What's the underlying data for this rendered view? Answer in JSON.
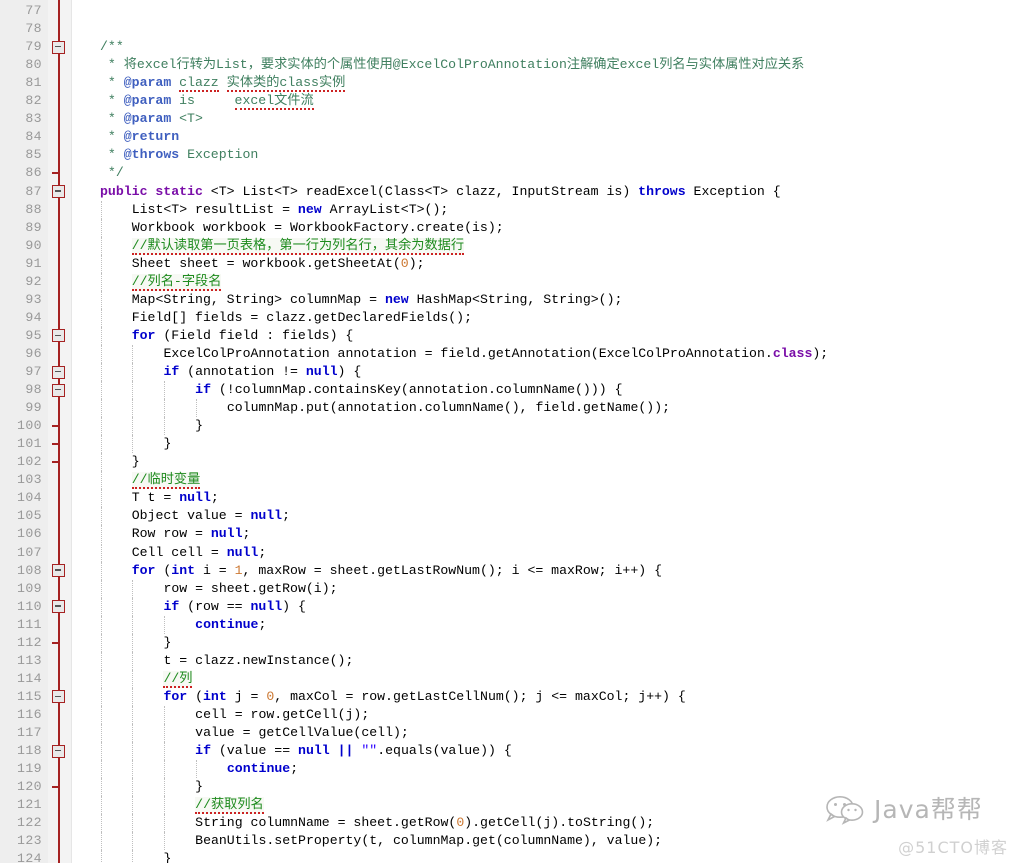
{
  "editor": {
    "first_line": 77,
    "last_line": 124,
    "language": "java",
    "colors": {
      "background": "#ffffff",
      "gutter_background": "#eeeeee",
      "line_number": "#999999",
      "fold_rail": "#a52222",
      "keyword_modifier": "#7a0ea8",
      "keyword": "#0000cc",
      "javadoc_comment": "#3f7f5f",
      "line_comment": "#1e8b1e",
      "javadoc_tag": "#3f5fbf",
      "number_literal": "#cc7832",
      "string_literal": "#2a00ff",
      "spellcheck_underline": "#cc2222",
      "indent_guide": "#bfbfbf"
    }
  },
  "lines": [
    {
      "n": 77,
      "indent": 0,
      "fold": "none",
      "tokens": []
    },
    {
      "n": 78,
      "indent": 0,
      "fold": "none",
      "tokens": []
    },
    {
      "n": 79,
      "indent": 1,
      "fold": "box",
      "tokens": [
        {
          "t": "/**",
          "c": "cmt"
        }
      ]
    },
    {
      "n": 80,
      "indent": 1,
      "fold": "line",
      "tokens": [
        {
          "t": " * 将excel行转为List，要求实体的个属性使用@ExcelColProAnnotation注解确定excel列名与实体属性对应关系",
          "c": "cmt"
        }
      ]
    },
    {
      "n": 81,
      "indent": 1,
      "fold": "line",
      "tokens": [
        {
          "t": " * ",
          "c": "cmt"
        },
        {
          "t": "@param",
          "c": "tag"
        },
        {
          "t": " ",
          "c": "cmt"
        },
        {
          "t": "clazz",
          "c": "cmt squig"
        },
        {
          "t": " ",
          "c": "cmt"
        },
        {
          "t": "实体类的class实例",
          "c": "cmt squig"
        }
      ]
    },
    {
      "n": 82,
      "indent": 1,
      "fold": "line",
      "tokens": [
        {
          "t": " * ",
          "c": "cmt"
        },
        {
          "t": "@param",
          "c": "tag"
        },
        {
          "t": " is     ",
          "c": "cmt"
        },
        {
          "t": "excel文件流",
          "c": "cmt squig"
        }
      ]
    },
    {
      "n": 83,
      "indent": 1,
      "fold": "line",
      "tokens": [
        {
          "t": " * ",
          "c": "cmt"
        },
        {
          "t": "@param",
          "c": "tag"
        },
        {
          "t": " <T>",
          "c": "cmt"
        }
      ]
    },
    {
      "n": 84,
      "indent": 1,
      "fold": "line",
      "tokens": [
        {
          "t": " * ",
          "c": "cmt"
        },
        {
          "t": "@return",
          "c": "tag"
        }
      ]
    },
    {
      "n": 85,
      "indent": 1,
      "fold": "line",
      "tokens": [
        {
          "t": " * ",
          "c": "cmt"
        },
        {
          "t": "@throws",
          "c": "tag"
        },
        {
          "t": " Exception",
          "c": "cmt"
        }
      ]
    },
    {
      "n": 86,
      "indent": 1,
      "fold": "tick",
      "tokens": [
        {
          "t": " */",
          "c": "cmt"
        }
      ]
    },
    {
      "n": 87,
      "indent": 1,
      "fold": "box",
      "tokens": [
        {
          "t": "public static",
          "c": "kw"
        },
        {
          "t": " <T> List<T> readExcel(Class<T> clazz, InputStream is) ",
          "c": "plain"
        },
        {
          "t": "throws",
          "c": "kw2"
        },
        {
          "t": " Exception {",
          "c": "plain"
        }
      ]
    },
    {
      "n": 88,
      "indent": 2,
      "fold": "none",
      "tokens": [
        {
          "t": "List<T> resultList = ",
          "c": "plain"
        },
        {
          "t": "new",
          "c": "kw2"
        },
        {
          "t": " ArrayList<T>();",
          "c": "plain"
        }
      ]
    },
    {
      "n": 89,
      "indent": 2,
      "fold": "none",
      "tokens": [
        {
          "t": "Workbook workbook = WorkbookFactory.create(is);",
          "c": "plain"
        }
      ]
    },
    {
      "n": 90,
      "indent": 2,
      "fold": "none",
      "tokens": [
        {
          "t": "//默认读取第一页表格，第一行为列名行，其余为数据行",
          "c": "cmtline squig cmt-hl"
        }
      ]
    },
    {
      "n": 91,
      "indent": 2,
      "fold": "none",
      "tokens": [
        {
          "t": "Sheet sheet = workbook.getSheetAt(",
          "c": "plain"
        },
        {
          "t": "0",
          "c": "num"
        },
        {
          "t": ");",
          "c": "plain"
        }
      ]
    },
    {
      "n": 92,
      "indent": 2,
      "fold": "none",
      "tokens": [
        {
          "t": "//列名-字段名",
          "c": "cmtline squig cmt-hl"
        }
      ]
    },
    {
      "n": 93,
      "indent": 2,
      "fold": "none",
      "tokens": [
        {
          "t": "Map<String, String> columnMap = ",
          "c": "plain"
        },
        {
          "t": "new",
          "c": "kw2"
        },
        {
          "t": " HashMap<String, String>();",
          "c": "plain"
        }
      ]
    },
    {
      "n": 94,
      "indent": 2,
      "fold": "none",
      "tokens": [
        {
          "t": "Field[] fields = clazz.getDeclaredFields();",
          "c": "plain"
        }
      ]
    },
    {
      "n": 95,
      "indent": 2,
      "fold": "box",
      "tokens": [
        {
          "t": "for",
          "c": "kw2"
        },
        {
          "t": " (Field field : fields) {",
          "c": "plain"
        }
      ]
    },
    {
      "n": 96,
      "indent": 3,
      "fold": "none",
      "tokens": [
        {
          "t": "ExcelColProAnnotation annotation = field.getAnnotation(ExcelColProAnnotation.",
          "c": "plain"
        },
        {
          "t": "class",
          "c": "kw"
        },
        {
          "t": ");",
          "c": "plain"
        }
      ]
    },
    {
      "n": 97,
      "indent": 3,
      "fold": "box",
      "tokens": [
        {
          "t": "if",
          "c": "kw2"
        },
        {
          "t": " (annotation != ",
          "c": "plain"
        },
        {
          "t": "null",
          "c": "kw2"
        },
        {
          "t": ") {",
          "c": "plain"
        }
      ]
    },
    {
      "n": 98,
      "indent": 4,
      "fold": "box",
      "tokens": [
        {
          "t": "if",
          "c": "kw2"
        },
        {
          "t": " (!columnMap.containsKey(annotation.columnName())) {",
          "c": "plain"
        }
      ]
    },
    {
      "n": 99,
      "indent": 5,
      "fold": "none",
      "tokens": [
        {
          "t": "columnMap.put(annotation.columnName(), field.getName());",
          "c": "plain"
        }
      ]
    },
    {
      "n": 100,
      "indent": 4,
      "fold": "tick",
      "tokens": [
        {
          "t": "}",
          "c": "plain"
        }
      ]
    },
    {
      "n": 101,
      "indent": 3,
      "fold": "tick",
      "tokens": [
        {
          "t": "}",
          "c": "plain"
        }
      ]
    },
    {
      "n": 102,
      "indent": 2,
      "fold": "tick",
      "tokens": [
        {
          "t": "}",
          "c": "plain"
        }
      ]
    },
    {
      "n": 103,
      "indent": 2,
      "fold": "none",
      "tokens": [
        {
          "t": "//临时变量",
          "c": "cmtline squig cmt-hl"
        }
      ]
    },
    {
      "n": 104,
      "indent": 2,
      "fold": "none",
      "tokens": [
        {
          "t": "T t = ",
          "c": "plain"
        },
        {
          "t": "null",
          "c": "kw2"
        },
        {
          "t": ";",
          "c": "plain"
        }
      ]
    },
    {
      "n": 105,
      "indent": 2,
      "fold": "none",
      "tokens": [
        {
          "t": "Object value = ",
          "c": "plain"
        },
        {
          "t": "null",
          "c": "kw2"
        },
        {
          "t": ";",
          "c": "plain"
        }
      ]
    },
    {
      "n": 106,
      "indent": 2,
      "fold": "none",
      "tokens": [
        {
          "t": "Row row = ",
          "c": "plain"
        },
        {
          "t": "null",
          "c": "kw2"
        },
        {
          "t": ";",
          "c": "plain"
        }
      ]
    },
    {
      "n": 107,
      "indent": 2,
      "fold": "none",
      "tokens": [
        {
          "t": "Cell cell = ",
          "c": "plain"
        },
        {
          "t": "null",
          "c": "kw2"
        },
        {
          "t": ";",
          "c": "plain"
        }
      ]
    },
    {
      "n": 108,
      "indent": 2,
      "fold": "box",
      "tokens": [
        {
          "t": "for",
          "c": "kw2"
        },
        {
          "t": " (",
          "c": "plain"
        },
        {
          "t": "int",
          "c": "kw2"
        },
        {
          "t": " i = ",
          "c": "plain"
        },
        {
          "t": "1",
          "c": "num"
        },
        {
          "t": ", maxRow = sheet.getLastRowNum(); i <= maxRow; i++) {",
          "c": "plain"
        }
      ]
    },
    {
      "n": 109,
      "indent": 3,
      "fold": "none",
      "tokens": [
        {
          "t": "row = sheet.getRow(i);",
          "c": "plain"
        }
      ]
    },
    {
      "n": 110,
      "indent": 3,
      "fold": "box",
      "tokens": [
        {
          "t": "if",
          "c": "kw2"
        },
        {
          "t": " (row == ",
          "c": "plain"
        },
        {
          "t": "null",
          "c": "kw2"
        },
        {
          "t": ") {",
          "c": "plain"
        }
      ]
    },
    {
      "n": 111,
      "indent": 4,
      "fold": "none",
      "tokens": [
        {
          "t": "continue",
          "c": "kw2"
        },
        {
          "t": ";",
          "c": "plain"
        }
      ]
    },
    {
      "n": 112,
      "indent": 3,
      "fold": "tick",
      "tokens": [
        {
          "t": "}",
          "c": "plain"
        }
      ]
    },
    {
      "n": 113,
      "indent": 3,
      "fold": "none",
      "tokens": [
        {
          "t": "t = clazz.newInstance();",
          "c": "plain"
        }
      ]
    },
    {
      "n": 114,
      "indent": 3,
      "fold": "none",
      "tokens": [
        {
          "t": "//列",
          "c": "cmtline squig cmt-hl"
        }
      ]
    },
    {
      "n": 115,
      "indent": 3,
      "fold": "box",
      "tokens": [
        {
          "t": "for",
          "c": "kw2"
        },
        {
          "t": " (",
          "c": "plain"
        },
        {
          "t": "int",
          "c": "kw2"
        },
        {
          "t": " j = ",
          "c": "plain"
        },
        {
          "t": "0",
          "c": "num"
        },
        {
          "t": ", maxCol = row.getLastCellNum(); j <= maxCol; j++) {",
          "c": "plain"
        }
      ]
    },
    {
      "n": 116,
      "indent": 4,
      "fold": "none",
      "tokens": [
        {
          "t": "cell = row.getCell(j);",
          "c": "plain"
        }
      ]
    },
    {
      "n": 117,
      "indent": 4,
      "fold": "none",
      "tokens": [
        {
          "t": "value = getCellValue(cell);",
          "c": "plain"
        }
      ]
    },
    {
      "n": 118,
      "indent": 4,
      "fold": "box",
      "tokens": [
        {
          "t": "if",
          "c": "kw2"
        },
        {
          "t": " (value == ",
          "c": "plain"
        },
        {
          "t": "null",
          "c": "kw2"
        },
        {
          "t": " ",
          "c": "plain"
        },
        {
          "t": "||",
          "c": "kw2"
        },
        {
          "t": " ",
          "c": "plain"
        },
        {
          "t": "\"\"",
          "c": "str"
        },
        {
          "t": ".equals(value)) {",
          "c": "plain"
        }
      ]
    },
    {
      "n": 119,
      "indent": 5,
      "fold": "none",
      "tokens": [
        {
          "t": "continue",
          "c": "kw2"
        },
        {
          "t": ";",
          "c": "plain"
        }
      ]
    },
    {
      "n": 120,
      "indent": 4,
      "fold": "tick",
      "tokens": [
        {
          "t": "}",
          "c": "plain"
        }
      ]
    },
    {
      "n": 121,
      "indent": 4,
      "fold": "none",
      "tokens": [
        {
          "t": "//获取列名",
          "c": "cmtline squig cmt-hl"
        }
      ]
    },
    {
      "n": 122,
      "indent": 4,
      "fold": "none",
      "tokens": [
        {
          "t": "String columnName = sheet.getRow(",
          "c": "plain"
        },
        {
          "t": "0",
          "c": "num"
        },
        {
          "t": ").getCell(j).toString();",
          "c": "plain"
        }
      ]
    },
    {
      "n": 123,
      "indent": 4,
      "fold": "none",
      "tokens": [
        {
          "t": "BeanUtils.setProperty(t, columnMap.get(columnName), value);",
          "c": "plain"
        }
      ]
    },
    {
      "n": 124,
      "indent": 3,
      "fold": "none",
      "tokens": [
        {
          "t": "}",
          "c": "plain"
        }
      ]
    }
  ],
  "watermark": {
    "icon": "wechat-icon",
    "brand": "Java帮帮",
    "source": "@51CTO博客"
  }
}
